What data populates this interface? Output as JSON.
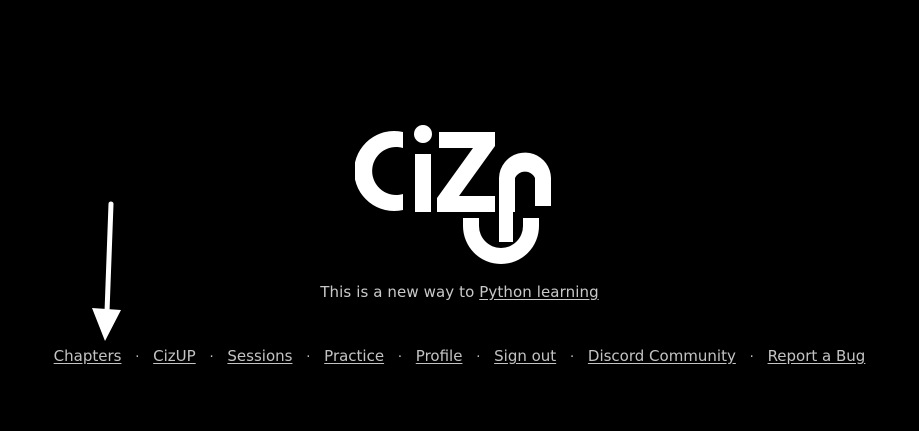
{
  "brand": {
    "logo_text": "CiZUP",
    "logo_icon": "cizup-logo"
  },
  "tagline": {
    "prefix": "This is a new way to ",
    "link": "Python learning"
  },
  "nav": {
    "separator": "·",
    "items": [
      {
        "label": "Chapters"
      },
      {
        "label": "CizUP"
      },
      {
        "label": "Sessions"
      },
      {
        "label": "Practice"
      },
      {
        "label": "Profile"
      },
      {
        "label": "Sign out"
      },
      {
        "label": "Discord Community"
      },
      {
        "label": "Report a Bug"
      }
    ]
  },
  "annotation": {
    "icon": "arrow-down-icon",
    "color": "#ffffff"
  },
  "colors": {
    "background": "#000000",
    "text": "#c9c9c9",
    "logo": "#ffffff"
  }
}
